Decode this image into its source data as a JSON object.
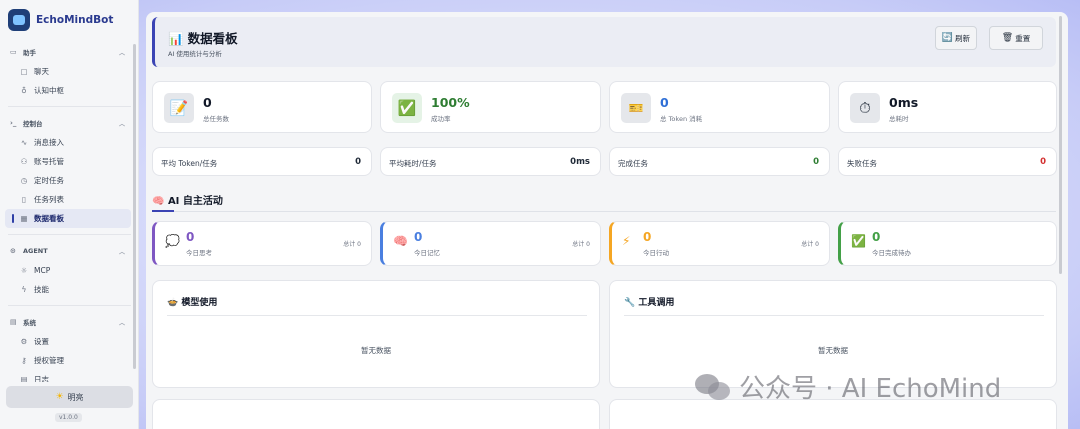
{
  "app": {
    "title": "EchoMindBot",
    "version": "v1.0.0",
    "theme_label": "明亮"
  },
  "sidebar": {
    "groups": [
      {
        "label": "助手",
        "icon": "chat-group-icon",
        "items": [
          {
            "label": "聊天",
            "icon": "chat-bubble-icon"
          },
          {
            "label": "认知中枢",
            "icon": "lightbulb-icon"
          }
        ]
      },
      {
        "label": "控制台",
        "icon": "terminal-icon",
        "items": [
          {
            "label": "消息接入",
            "icon": "pulse-icon"
          },
          {
            "label": "账号托管",
            "icon": "users-icon"
          },
          {
            "label": "定时任务",
            "icon": "clock-icon"
          },
          {
            "label": "任务列表",
            "icon": "clipboard-icon"
          },
          {
            "label": "数据看板",
            "icon": "grid-icon",
            "active": true
          }
        ]
      },
      {
        "label": "AGENT",
        "icon": "agent-icon",
        "items": [
          {
            "label": "MCP",
            "icon": "sun-gear-icon"
          },
          {
            "label": "技能",
            "icon": "lightning-icon"
          }
        ]
      },
      {
        "label": "系统",
        "icon": "system-icon",
        "items": [
          {
            "label": "设置",
            "icon": "gear-icon"
          },
          {
            "label": "授权管理",
            "icon": "key-icon"
          },
          {
            "label": "日志",
            "icon": "document-icon"
          }
        ]
      }
    ]
  },
  "header": {
    "title": "数据看板",
    "subtitle": "AI 使用统计与分析",
    "refresh_label": "刷新",
    "reset_label": "重置"
  },
  "stats": [
    {
      "value": "0",
      "label": "总任务数",
      "icon": "memo-icon",
      "color": "#111827"
    },
    {
      "value": "100%",
      "label": "成功率",
      "icon": "check-box-icon",
      "color": "#2e7d32"
    },
    {
      "value": "0",
      "label": "总 Token 消耗",
      "icon": "ticket-icon",
      "color": "#2f6fd6"
    },
    {
      "value": "0ms",
      "label": "总耗时",
      "icon": "stopwatch-icon",
      "color": "#111827"
    }
  ],
  "mini_stats": [
    {
      "label": "平均 Token/任务",
      "value": "0",
      "color": "#111827"
    },
    {
      "label": "平均耗时/任务",
      "value": "0ms",
      "color": "#111827"
    },
    {
      "label": "完成任务",
      "value": "0",
      "color": "#2e7d32"
    },
    {
      "label": "失败任务",
      "value": "0",
      "color": "#d32f2f"
    }
  ],
  "activity": {
    "title": "AI 自主活动",
    "cards": [
      {
        "value": "0",
        "label": "今日思考",
        "total": "总计 0",
        "icon": "thought-bubble-icon",
        "accent": "#7e57c2"
      },
      {
        "value": "0",
        "label": "今日记忆",
        "total": "总计 0",
        "icon": "brain-icon",
        "accent": "#4a7fe0"
      },
      {
        "value": "0",
        "label": "今日行动",
        "total": "总计 0",
        "icon": "lightning-icon",
        "accent": "#f5a623"
      },
      {
        "value": "0",
        "label": "今日完成待办",
        "total": "",
        "icon": "check-box-icon",
        "accent": "#43a047"
      }
    ]
  },
  "panels": [
    {
      "title": "模型使用",
      "icon": "pot-icon",
      "empty": "暂无数据"
    },
    {
      "title": "工具调用",
      "icon": "wrench-icon",
      "empty": "暂无数据"
    }
  ],
  "watermark": "公众号 · AI EchoMind"
}
